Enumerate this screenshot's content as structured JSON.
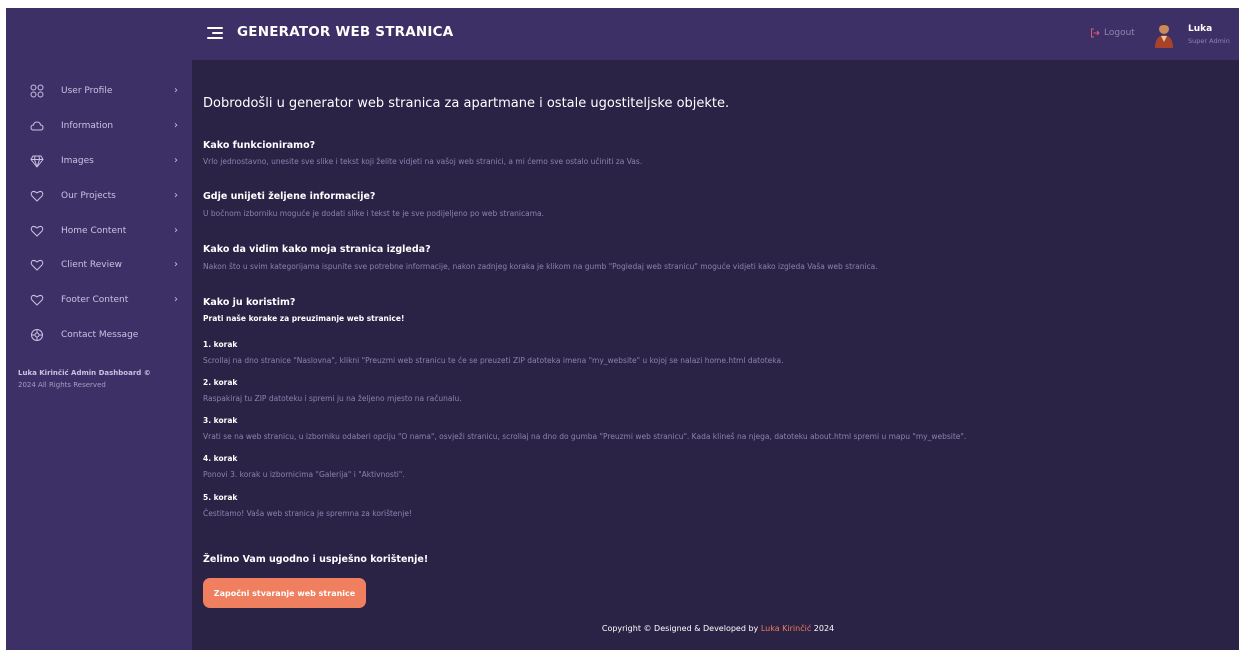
{
  "header": {
    "title": "GENERATOR WEB STRANICA",
    "logout_label": "Logout",
    "user_name": "Luka",
    "user_role": "Super Admin",
    "accent": "#ef7f5e",
    "logout_color": "#e0577a"
  },
  "sidebar": {
    "items": [
      {
        "label": "User Profile",
        "icon": "grid-icon"
      },
      {
        "label": "Information",
        "icon": "cloud-icon"
      },
      {
        "label": "Images",
        "icon": "diamond-icon"
      },
      {
        "label": "Our Projects",
        "icon": "heart-icon"
      },
      {
        "label": "Home Content",
        "icon": "heart-icon"
      },
      {
        "label": "Client Review",
        "icon": "heart-icon"
      },
      {
        "label": "Footer Content",
        "icon": "heart-icon"
      },
      {
        "label": "Contact Message",
        "icon": "gear-icon"
      }
    ],
    "footer_name": "Luka Kirinčić Admin Dashboard ©",
    "footer_rights": "2024 All Rights Reserved"
  },
  "main": {
    "welcome": "Dobrodošli u generator web stranica za apartmane i ostale ugostiteljske objekte.",
    "q1_title": "Kako funkcioniramo?",
    "q1_text": "Vrlo jednostavno, unesite sve slike i tekst koji želite vidjeti na vašoj web stranici, a mi ćemo sve ostalo učiniti za Vas.",
    "q2_title": "Gdje unijeti željene informacije?",
    "q2_text": "U bočnom izborniku moguće je dodati slike i tekst te je sve podijeljeno po web stranicama.",
    "q3_title": "Kako da vidim kako moja stranica izgleda?",
    "q3_text": "Nakon što u svim kategorijama ispunite sve potrebne informacije, nakon zadnjeg koraka je klikom na gumb \"Pogledaj web stranicu\" moguće vidjeti kako izgleda Vaša web stranica.",
    "q4_title": "Kako ju koristim?",
    "q4_sub": "Prati naše korake za preuzimanje web stranice!",
    "steps": [
      {
        "title": "1. korak",
        "text": "Scrollaj na dno stranice \"Naslovna\", klikni \"Preuzmi web stranicu te će se preuzeti ZIP datoteka imena \"my_website\" u kojoj se nalazi home.html datoteka."
      },
      {
        "title": "2. korak",
        "text": "Raspakiraj tu ZIP datoteku i spremi ju na željeno mjesto na računalu."
      },
      {
        "title": "3. korak",
        "text": "Vrati se na web stranicu, u izborniku odaberi opciju \"O nama\", osvježi stranicu, scrollaj na dno do gumba \"Preuzmi web stranicu\". Kada klineš na njega, datoteku about.html spremi u mapu \"my_website\"."
      },
      {
        "title": "4. korak",
        "text": "Ponovi 3. korak u izbornicima \"Galerija\" i \"Aktivnosti\"."
      },
      {
        "title": "5. korak",
        "text": "Čestitamo! Vaša web stranica je spremna za korištenje!"
      }
    ],
    "closing": "Želimo Vam ugodno i uspješno korištenje!",
    "cta_label": "Započni stvaranje web stranice"
  },
  "footer": {
    "prefix": "Copyright © Designed & Developed by",
    "author": "Luka Kirinčić",
    "year": "2024"
  }
}
